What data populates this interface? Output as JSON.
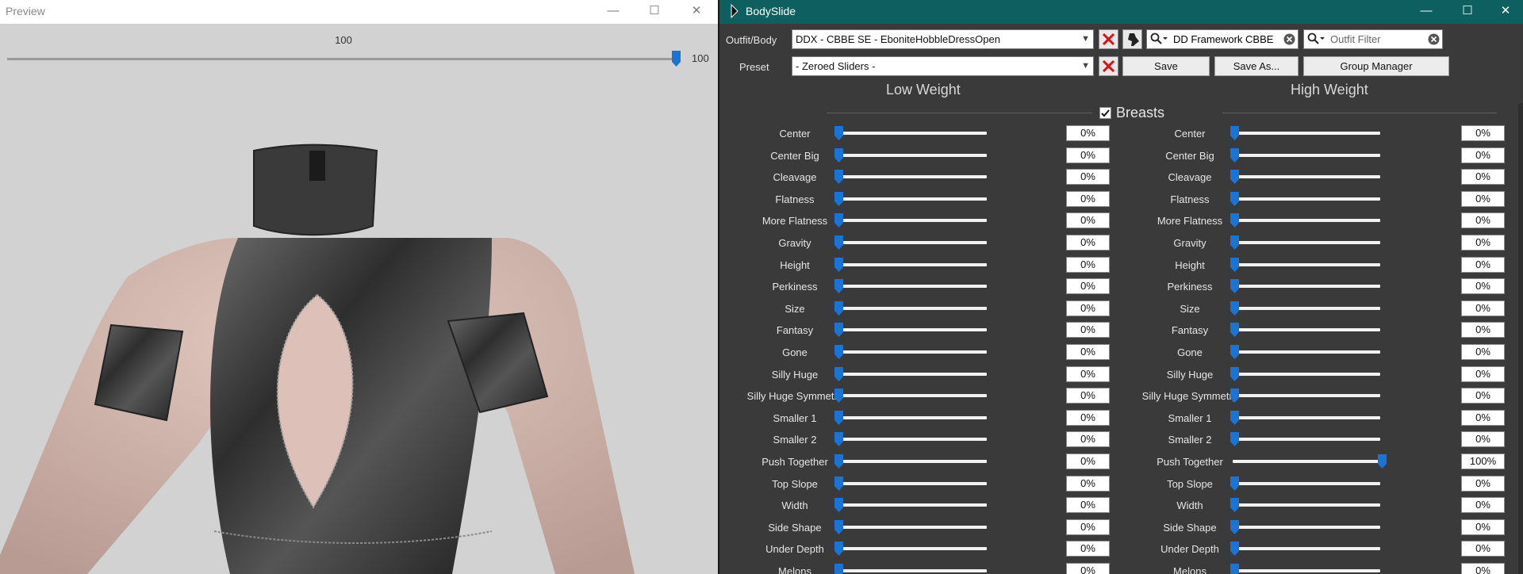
{
  "preview": {
    "title": "Preview",
    "slider_value": "100",
    "slider_value_right": "100",
    "slider_fraction": 1.0
  },
  "bodyslide": {
    "title": "BodySlide",
    "outfit_label": "Outfit/Body",
    "outfit_value": "DDX - CBBE SE - EboniteHobbleDressOpen",
    "preset_label": "Preset",
    "preset_value": "- Zeroed Sliders -",
    "group_filter_value": "DD Framework CBBE",
    "outfit_filter_placeholder": "Outfit Filter",
    "save_label": "Save",
    "save_as_label": "Save As...",
    "group_manager_label": "Group Manager",
    "low_weight_label": "Low Weight",
    "high_weight_label": "High Weight",
    "category": {
      "label": "Breasts",
      "checked": true
    },
    "accent_color": "#0e5f60",
    "slider_color": "#1a73d6",
    "sliders": [
      {
        "label": "Center",
        "low": "0%",
        "high": "0%",
        "low_frac": 0,
        "high_frac": 0
      },
      {
        "label": "Center Big",
        "low": "0%",
        "high": "0%",
        "low_frac": 0,
        "high_frac": 0
      },
      {
        "label": "Cleavage",
        "low": "0%",
        "high": "0%",
        "low_frac": 0,
        "high_frac": 0
      },
      {
        "label": "Flatness",
        "low": "0%",
        "high": "0%",
        "low_frac": 0,
        "high_frac": 0
      },
      {
        "label": "More Flatness",
        "low": "0%",
        "high": "0%",
        "low_frac": 0,
        "high_frac": 0
      },
      {
        "label": "Gravity",
        "low": "0%",
        "high": "0%",
        "low_frac": 0,
        "high_frac": 0
      },
      {
        "label": "Height",
        "low": "0%",
        "high": "0%",
        "low_frac": 0,
        "high_frac": 0
      },
      {
        "label": "Perkiness",
        "low": "0%",
        "high": "0%",
        "low_frac": 0,
        "high_frac": 0
      },
      {
        "label": "Size",
        "low": "0%",
        "high": "0%",
        "low_frac": 0,
        "high_frac": 0
      },
      {
        "label": "Fantasy",
        "low": "0%",
        "high": "0%",
        "low_frac": 0,
        "high_frac": 0
      },
      {
        "label": "Gone",
        "low": "0%",
        "high": "0%",
        "low_frac": 0,
        "high_frac": 0
      },
      {
        "label": "Silly Huge",
        "low": "0%",
        "high": "0%",
        "low_frac": 0,
        "high_frac": 0
      },
      {
        "label": "Silly Huge Symmetry",
        "low": "0%",
        "high": "0%",
        "low_frac": 0,
        "high_frac": 0
      },
      {
        "label": "Smaller 1",
        "low": "0%",
        "high": "0%",
        "low_frac": 0,
        "high_frac": 0
      },
      {
        "label": "Smaller 2",
        "low": "0%",
        "high": "0%",
        "low_frac": 0,
        "high_frac": 0
      },
      {
        "label": "Push Together",
        "low": "0%",
        "high": "100%",
        "low_frac": 0,
        "high_frac": 1
      },
      {
        "label": "Top Slope",
        "low": "0%",
        "high": "0%",
        "low_frac": 0,
        "high_frac": 0
      },
      {
        "label": "Width",
        "low": "0%",
        "high": "0%",
        "low_frac": 0,
        "high_frac": 0
      },
      {
        "label": "Side Shape",
        "low": "0%",
        "high": "0%",
        "low_frac": 0,
        "high_frac": 0
      },
      {
        "label": "Under Depth",
        "low": "0%",
        "high": "0%",
        "low_frac": 0,
        "high_frac": 0
      },
      {
        "label": "Melons",
        "low": "0%",
        "high": "0%",
        "low_frac": 0,
        "high_frac": 0
      }
    ]
  }
}
